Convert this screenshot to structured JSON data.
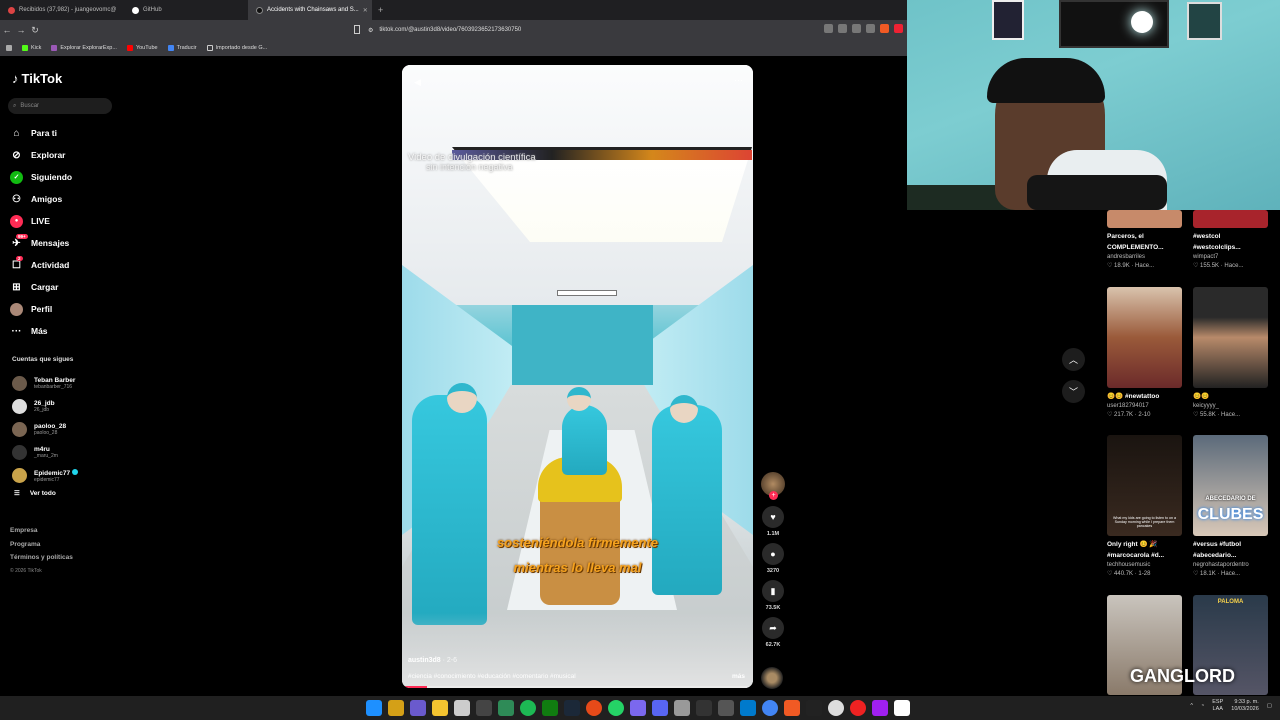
{
  "browser": {
    "tabs": [
      {
        "title": "Recibidos (37,982) - juangeovomc@"
      },
      {
        "title": "GitHub"
      },
      {
        "title": "Accidents with Chainsaws and S..."
      }
    ],
    "new_tab": "+",
    "url": "tiktok.com/@austin3d8/video/7603923652173630750",
    "bookmarks": [
      "Kick",
      "Explorar ExplorarExp...",
      "YouTube",
      "Traducir",
      "Importado desde G..."
    ]
  },
  "sidebar": {
    "logo": "TikTok",
    "search_placeholder": "Buscar",
    "nav": [
      {
        "label": "Para ti",
        "icon": "home-icon"
      },
      {
        "label": "Explorar",
        "icon": "compass-icon"
      },
      {
        "label": "Siguiendo",
        "icon": "following-icon"
      },
      {
        "label": "Amigos",
        "icon": "friends-icon"
      },
      {
        "label": "LIVE",
        "icon": "live-icon"
      },
      {
        "label": "Mensajes",
        "icon": "messages-icon",
        "badge": "99+"
      },
      {
        "label": "Actividad",
        "icon": "activity-icon",
        "badge": "2"
      },
      {
        "label": "Cargar",
        "icon": "upload-icon"
      },
      {
        "label": "Perfil",
        "icon": "profile-icon"
      },
      {
        "label": "Más",
        "icon": "more-icon"
      }
    ],
    "following_header": "Cuentas que sigues",
    "following": [
      {
        "name": "Teban Barber",
        "handle": "tebanbarber_716"
      },
      {
        "name": "26_jdb",
        "handle": "26_jdb"
      },
      {
        "name": "paoloo_28",
        "handle": "paoloo_28"
      },
      {
        "name": "m4ru",
        "handle": "_maru_2m"
      },
      {
        "name": "Epidemic77",
        "handle": "epidemic77",
        "verified": true
      }
    ],
    "see_all": "Ver todo",
    "footer": [
      "Empresa",
      "Programa",
      "Términos y políticas"
    ],
    "copyright": "© 2026 TikTok"
  },
  "video": {
    "overlay_title": "Video de divulgación científica",
    "overlay_sub": "sin intención negativa",
    "caption_line1": "sosteniéndola firmemente",
    "caption_line2": "mientras lo lleva mal",
    "author": "austin3d8",
    "date": "· 2-6",
    "tags": "#ciencia #conocimiento #educación #comentario #musical",
    "more": "más",
    "progress": 0.07
  },
  "actions": {
    "likes": "1.1M",
    "comments": "3270",
    "saves": "73.5K",
    "shares": "62.7K"
  },
  "grid": [
    {
      "title": "Parceros, el COMPLEMENTO...",
      "user": "andresbarriles",
      "stats": "♡ 18.9K · Hace..."
    },
    {
      "title": "#westcol #westcolclips...",
      "user": "wimpact7",
      "stats": "♡ 155.5K · Hace..."
    },
    {
      "title": "😊😊 #newtattoo",
      "user": "user182794017",
      "stats": "♡ 217.7K · 2-10"
    },
    {
      "title": "😊😊",
      "user": "keicyyyy_",
      "stats": "♡ 55.8K · Hace..."
    },
    {
      "title": "Only right 😊 🎉 #marcocarola #d...",
      "user": "techhousemusic",
      "stats": "♡ 440.7K · 1-28"
    },
    {
      "title": "#versus #futbol #abecedario...",
      "user": "negrohastapordentro",
      "stats": "♡ 18.1K · Hace..."
    },
    {
      "title": "",
      "user": "",
      "stats": ""
    },
    {
      "title": "",
      "user": "",
      "stats": ""
    }
  ],
  "thumb_texts": {
    "abecedario_line1": "ABECEDARIO DE",
    "abecedario_line2": "CLUBES",
    "ganglord": "GANGLORD",
    "paloma": "PALOMA",
    "pancakes": "What my kids are going to listen to on a Sunday morning while I prepare them pancakes"
  },
  "taskbar": {
    "lang1": "ESP",
    "lang2": "LAA",
    "time": "9:33 p. m.",
    "date": "10/03/2026"
  },
  "colors": {
    "accent": "#fe2c55",
    "caption": "#f5a21e",
    "teal": "#20d5ec"
  }
}
